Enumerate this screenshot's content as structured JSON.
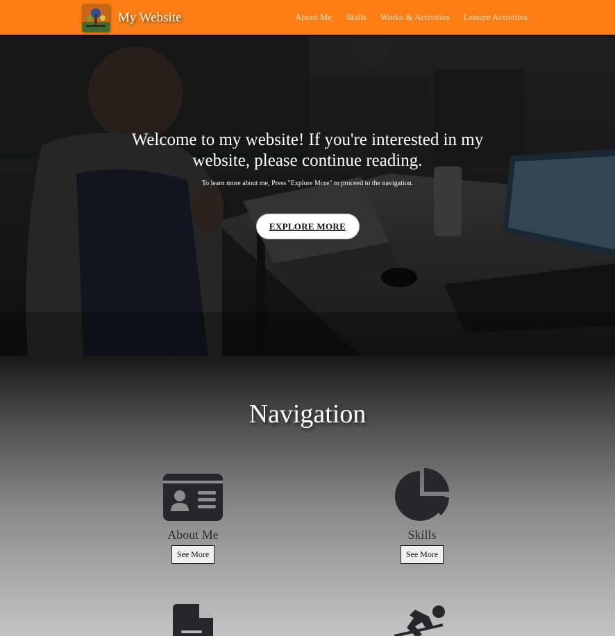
{
  "header": {
    "brand": "My Website",
    "nav": [
      "About Me",
      "Skills",
      "Works & Activities",
      "Leisure Activities"
    ]
  },
  "hero": {
    "title": "Welcome to my website! If you're interested in my website, please continue reading.",
    "subtitle": "To learn more about me, Press \"Explore More\" to proceed to the navigation.",
    "button": "EXPLORE MORE"
  },
  "navigation": {
    "title": "Navigation",
    "cards": [
      {
        "label": "About Me",
        "button": "See More",
        "icon": "id-card-icon"
      },
      {
        "label": "Skills",
        "button": "See More",
        "icon": "pie-chart-icon"
      },
      {
        "label": "",
        "button": "",
        "icon": "document-icon"
      },
      {
        "label": "",
        "button": "",
        "icon": "skiing-icon"
      }
    ]
  },
  "colors": {
    "navbar": "#fd7e14",
    "icon": "#25272c"
  }
}
